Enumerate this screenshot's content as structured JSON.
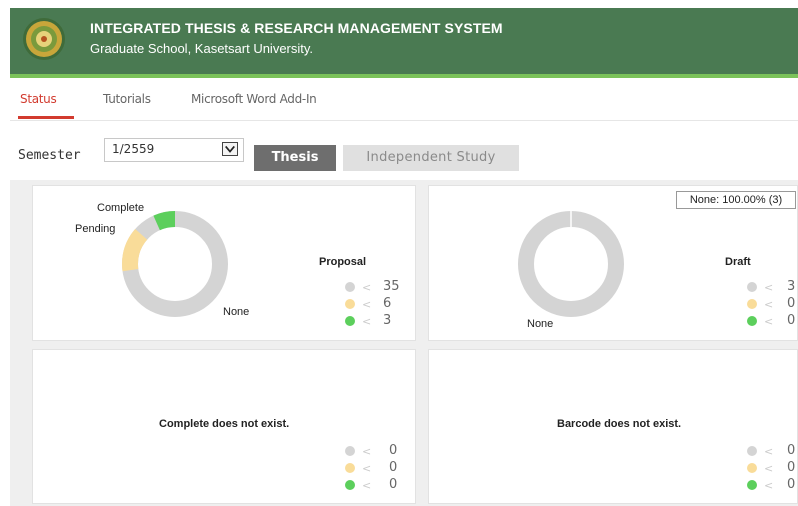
{
  "header": {
    "title": "INTEGRATED THESIS & RESEARCH MANAGEMENT SYSTEM",
    "subtitle": "Graduate School, Kasetsart University."
  },
  "tabs": [
    {
      "label": "Status",
      "active": true
    },
    {
      "label": "Tutorials",
      "active": false
    },
    {
      "label": "Microsoft Word Add-In",
      "active": false
    }
  ],
  "filter": {
    "semester_label": "Semester",
    "semester_value": "1/2559",
    "thesis_button": "Thesis",
    "independent_study_button": "Independent Study"
  },
  "colors": {
    "none": "#d4d4d4",
    "pending": "#f9dc99",
    "complete": "#5ccf5c",
    "header_bg": "#4a7a52",
    "accent": "#d23b2f"
  },
  "panels": {
    "proposal": {
      "title": "Proposal",
      "chart_labels": {
        "complete": "Complete",
        "pending": "Pending",
        "none": "None"
      },
      "legend": [
        {
          "status": "none",
          "symbol": "<",
          "value": "35"
        },
        {
          "status": "pending",
          "symbol": "<",
          "value": "6"
        },
        {
          "status": "complete",
          "symbol": "<",
          "value": "3"
        }
      ]
    },
    "draft": {
      "title": "Draft",
      "chart_labels": {
        "none": "None"
      },
      "tooltip": "None: 100.00% (3)",
      "legend": [
        {
          "status": "none",
          "symbol": "<",
          "value": "3"
        },
        {
          "status": "pending",
          "symbol": "<",
          "value": "0"
        },
        {
          "status": "complete",
          "symbol": "<",
          "value": "0"
        }
      ]
    },
    "complete": {
      "message": "Complete does not exist.",
      "legend": [
        {
          "status": "none",
          "symbol": "<",
          "value": "0"
        },
        {
          "status": "pending",
          "symbol": "<",
          "value": "0"
        },
        {
          "status": "complete",
          "symbol": "<",
          "value": "0"
        }
      ]
    },
    "barcode": {
      "message": "Barcode does not exist.",
      "legend": [
        {
          "status": "none",
          "symbol": "<",
          "value": "0"
        },
        {
          "status": "pending",
          "symbol": "<",
          "value": "0"
        },
        {
          "status": "complete",
          "symbol": "<",
          "value": "0"
        }
      ]
    }
  }
}
